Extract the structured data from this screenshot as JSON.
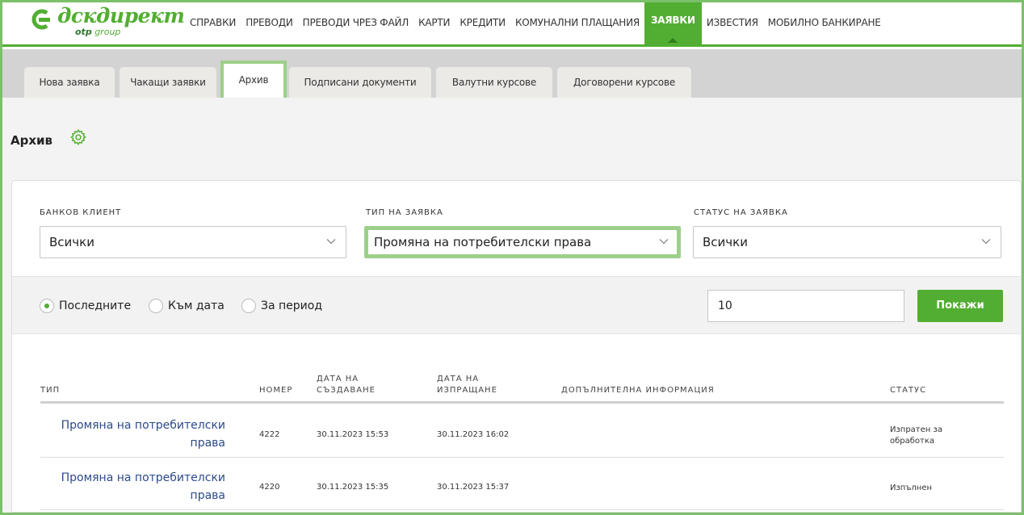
{
  "brand": {
    "name": "дскдирект",
    "sub_prefix": "otp",
    "sub_suffix": "group",
    "color": "#52ae32"
  },
  "nav": [
    {
      "label": "СПРАВКИ"
    },
    {
      "label": "ПРЕВОДИ"
    },
    {
      "label": "ПРЕВОДИ ЧРЕЗ ФАЙЛ"
    },
    {
      "label": "КАРТИ"
    },
    {
      "label": "КРЕДИТИ"
    },
    {
      "label": "КОМУНАЛНИ ПЛАЩАНИЯ"
    },
    {
      "label": "ЗАЯВКИ",
      "active": true
    },
    {
      "label": "ИЗВЕСТИЯ"
    },
    {
      "label": "МОБИЛНО БАНКИРАНЕ"
    }
  ],
  "tabs": [
    {
      "label": "Нова заявка"
    },
    {
      "label": "Чакащи заявки"
    },
    {
      "label": "Архив",
      "active": true
    },
    {
      "label": "Подписани документи"
    },
    {
      "label": "Валутни курсове"
    },
    {
      "label": "Договорени курсове"
    }
  ],
  "page": {
    "title": "Архив",
    "settings_icon": "gear-icon"
  },
  "filters": {
    "client": {
      "label": "БАНКОВ КЛИЕНТ",
      "value": "Всички"
    },
    "type": {
      "label": "ТИП НА ЗАЯВКА",
      "value": "Промяна на потребителски права"
    },
    "status": {
      "label": "СТАТУС НА ЗАЯВКА",
      "value": "Всички"
    },
    "radios": [
      {
        "label": "Последните",
        "checked": true
      },
      {
        "label": "Към дата",
        "checked": false
      },
      {
        "label": "За период",
        "checked": false
      }
    ],
    "count": "10",
    "show_label": "Покажи"
  },
  "table": {
    "headers": {
      "type": "ТИП",
      "number": "НОМЕР",
      "created_1": "ДАТА НА",
      "created_2": "СЪЗДАВАНЕ",
      "sent_1": "ДАТА НА",
      "sent_2": "ИЗПРАЩАНЕ",
      "info": "ДОПЪЛНИТЕЛНА ИНФОРМАЦИЯ",
      "status": "СТАТУС"
    },
    "rows": [
      {
        "type_1": "Промяна на потребителски",
        "type_2": "права",
        "number": "4222",
        "created": "30.11.2023 15:53",
        "sent": "30.11.2023 16:02",
        "info": "",
        "status_1": "Изпратен за",
        "status_2": "обработка"
      },
      {
        "type_1": "Промяна на потребителски",
        "type_2": "права",
        "number": "4220",
        "created": "30.11.2023 15:35",
        "sent": "30.11.2023 15:37",
        "info": "",
        "status_1": "Изпълнен",
        "status_2": ""
      }
    ]
  }
}
